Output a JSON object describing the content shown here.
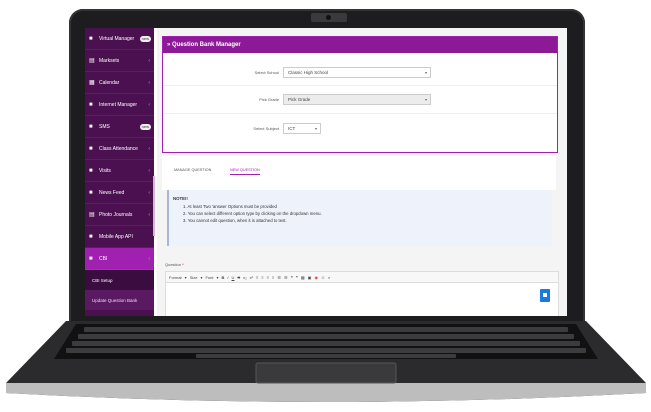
{
  "sidebar": {
    "items": [
      {
        "icon": "■",
        "label": "Virtual Manager",
        "badge": "new"
      },
      {
        "icon": "▤",
        "label": "Marksets",
        "chevron": "‹"
      },
      {
        "icon": "▦",
        "label": "Calendar",
        "chevron": "‹"
      },
      {
        "icon": "■",
        "label": "Internet Manager",
        "chevron": "‹"
      },
      {
        "icon": "■",
        "label": "SMS",
        "badge": "new"
      },
      {
        "icon": "■",
        "label": "Class Attendance",
        "chevron": "‹"
      },
      {
        "icon": "■",
        "label": "Visits",
        "chevron": "‹"
      },
      {
        "icon": "■",
        "label": "News Feed",
        "chevron": "‹"
      },
      {
        "icon": "▤",
        "label": "Photo Journals",
        "chevron": "‹"
      },
      {
        "icon": "■",
        "label": "Mobile App API",
        "chevron": ""
      },
      {
        "icon": "■",
        "label": "CBI",
        "chevron": "‹"
      }
    ],
    "sub_items": [
      {
        "label": "CBI Setup"
      },
      {
        "label": "Update Question Bank"
      }
    ]
  },
  "panel": {
    "title": "» Question Bank Manager",
    "fields": [
      {
        "label": "Select School",
        "value": "Classic High School"
      },
      {
        "label": "Pick Grade",
        "value": "Pick Grade"
      },
      {
        "label": "Select Subject",
        "value": "ICT"
      }
    ]
  },
  "tabs": [
    {
      "label": "MANAGE QUESTION"
    },
    {
      "label": "NEW QUESTION"
    }
  ],
  "note": {
    "title": "NOTE!!",
    "lines": [
      "1. At least Two 'answer Options must be provided",
      "2. You can select different option type by clicking on the dropdown menu.",
      "3. You cannot edit question, when it is attached to test."
    ]
  },
  "editor": {
    "label": "Question",
    "required_mark": "*",
    "toolbar": [
      "Format",
      "▾",
      "Size",
      "▾",
      "Font",
      "▾",
      "B",
      "I",
      "U",
      "S",
      "x₂",
      "x²",
      "≡",
      "≡",
      "≡",
      "≡",
      "☰",
      "☰",
      "❝",
      "❞",
      "▦",
      "▣",
      "◉",
      "☺",
      "⌕"
    ]
  },
  "colors": {
    "sidebar": "#4a1050",
    "accent": "#8c1a96",
    "active": "#a020b0"
  }
}
